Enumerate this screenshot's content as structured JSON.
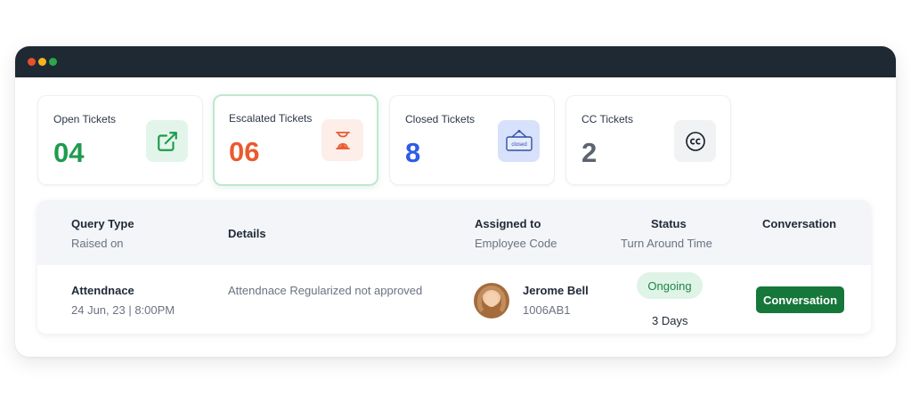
{
  "window": {
    "title_dots": [
      "close",
      "minimize",
      "maximize"
    ],
    "colors": {
      "titlebar": "#1f2933",
      "red": "#e8502a",
      "yellow": "#f3b51f",
      "green": "#2aa84a"
    }
  },
  "cards": [
    {
      "label": "Open Tickets",
      "value": "04",
      "color": "#1e9b4f",
      "icon": "external-link-icon",
      "icon_bg": "#e3f5ea",
      "active": false
    },
    {
      "label": "Escalated Tickets",
      "value": "06",
      "color": "#ea5a2e",
      "icon": "hourglass-icon",
      "icon_bg": "#fdeeea",
      "active": true
    },
    {
      "label": "Closed Tickets",
      "value": "8",
      "color": "#2f5bea",
      "icon": "closed-sign-icon",
      "icon_text": "closed",
      "icon_bg": "#d7e1fb",
      "active": false
    },
    {
      "label": "CC Tickets",
      "value": "2",
      "color": "#5b6470",
      "icon": "cc-icon",
      "icon_bg": "#f1f2f4",
      "active": false
    }
  ],
  "table": {
    "headers": {
      "query_type": "Query Type",
      "raised_on": "Raised on",
      "details": "Details",
      "assigned_to": "Assigned to",
      "employee_code": "Employee Code",
      "status": "Status",
      "turn_around_time": "Turn Around Time",
      "conversation": "Conversation"
    },
    "rows": [
      {
        "query_type": "Attendnace",
        "raised_on": "24 Jun, 23 | 8:00PM",
        "details": "Attendnace Regularized not approved",
        "assignee_name": "Jerome Bell",
        "employee_code": "1006AB1",
        "status": "Ongoing",
        "turn_around_time": "3 Days",
        "conversation_label": "Conversation"
      }
    ]
  }
}
